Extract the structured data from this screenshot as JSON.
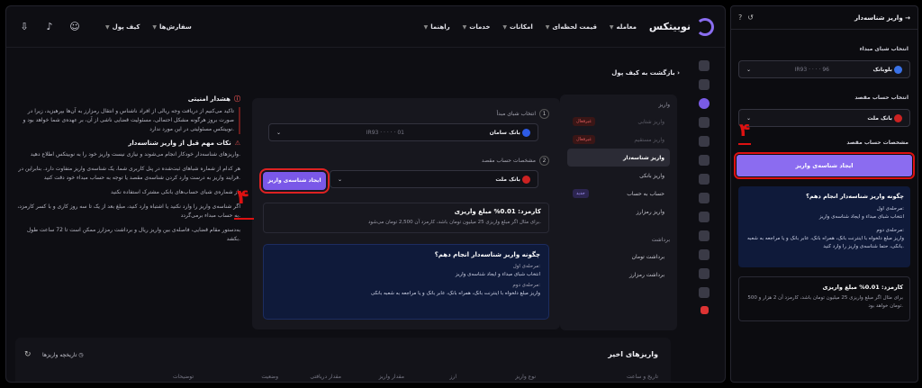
{
  "topbar": {
    "logo": "نوبیتکس",
    "nav": [
      "معامله",
      "قیمت لحظه‌ای",
      "امکانات",
      "خدمات",
      "راهنما"
    ],
    "menu": [
      "سفارش‌ها",
      "کیف پول"
    ]
  },
  "breadcrumb": "بازگشت به کیف پول",
  "deposit_menu": {
    "title": "واریز",
    "items": [
      {
        "label": "واریز شتابی",
        "badge": "غیرفعال"
      },
      {
        "label": "واریز مستقیم",
        "badge": "غیرفعال"
      },
      {
        "label": "واریز شناسه‌دار",
        "badge": ""
      },
      {
        "label": "واریز بانکی",
        "badge": ""
      },
      {
        "label": "حساب به حساب",
        "badge": "جدید"
      },
      {
        "label": "واریز رمزارز",
        "badge": ""
      }
    ],
    "withdraw_title": "برداشت",
    "withdraw_items": [
      "برداشت تومان",
      "برداشت رمزارز"
    ]
  },
  "form": {
    "step1_label": "انتخاب شبای مبدأ",
    "step1_num": "1",
    "source_bank": "بانک سامان",
    "source_iban_start": "IR93",
    "source_iban_end": "01",
    "step2_label": "مشخصات حساب مقصد",
    "step2_num": "2",
    "dest_bank": "بانک ملت",
    "create_button": "ایجاد شناسه‌ی واریز",
    "fee_title": "کارمزد: 0.01% مبلغ واریزی",
    "fee_text": "برای مثال اگر مبلغ واریزی 25 میلیون تومان باشد، کارمزد آن 2,500 تومان می‌شود.",
    "how_title": "چگونه واریز شناسه‌دار انجام دهم؟",
    "how_step1_label": "مرحله‌ی اول:",
    "how_step1": "انتخاب شبای مبداء و ایجاد شناسه‌ی واریز",
    "how_step2_label": "مرحله‌ی دوم:",
    "how_step2": "واریز مبلغ دلخواه با اینترنت بانک، همراه بانک، عابر بانک و یا مراجعه به شعبه بانکی"
  },
  "notes": {
    "security_title": "هشدار امنیتی",
    "security_text": "تاکید می‌کنیم از دریافت وجه ریالی از افراد ناشناس و انتقال رمزارز به آن‌ها بپرهیزید، زیرا در صورت بروز هرگونه مشکل احتمالی، مسئولیت قضایی ناشی از آن، بر عهده‌ی شما خواهد بود و نوبیتکس مسئولیتی در این مورد ندارد.",
    "tips_title": "نکات مهم قبل از واریز شناسه‌دار",
    "tips": [
      "واریزهای شناسه‌دار خودکار انجام می‌شوند و نیازی نیست واریز خود را به نوبیتکس اطلاع دهید.",
      "هر کدام از شماره شباهای ثبت‌شده در پنل کاربری شما، یک شناسه‌ی واریز متفاوت دارد. بنابراین در فرایند واریز به درست وارد کردن شناسه‌ی مقصد یا توجه به حساب مبداء خود دقت کنید.",
      "از شماره‌ی شبای حساب‌های بانکی مشترک استفاده نکنید.",
      "اگر شناسه‌ی واریز را وارد نکنید یا اشتباه وارد کنید، مبلغ بعد از یک تا سه روز کاری و با کسر کارمزد، به حساب مبداء برمی‌گردد.",
      "به‌دستور مقام قضایی، فاصله‌ی بین واریز ریال و برداشت رمزارز ممکن است تا 72 ساعت طول بکشد."
    ]
  },
  "annotation": "۴",
  "recent": {
    "title": "واریزهای اخیر",
    "history": "تاریخچه واریزها",
    "columns": [
      "تاریخ و ساعت",
      "نوع واریز",
      "ارز",
      "مقدار واریز",
      "مقدار دریافتی",
      "وضعیت",
      "توضیحات"
    ]
  },
  "panel": {
    "title": "واریز شناسه‌دار",
    "source_label": "انتخاب شبای مبداء",
    "source_bank": "بلوبانک",
    "source_iban_start": "IR93",
    "source_iban_end": "96",
    "dest_label": "انتخاب حساب مقصد",
    "dest_bank": "بانک ملت",
    "dest_info_label": "مشخصات حساب مقصد",
    "create_button": "ایجاد شناسه‌ی واریز",
    "how_title": "چگونه واریز شناسه‌دار انجام دهم؟",
    "step1_label": "مرحله‌ی اول:",
    "step1": "انتخاب شبای مبداء و ایجاد شناسه‌ی واریز",
    "step2_label": "مرحله‌ی دوم:",
    "step2": "واریز مبلغ دلخواه با اینترنت بانک، همراه بانک، عابر بانک و یا مراجعه به شعبه بانکی، حتما شناسه‌ی واریز را وارد کنید.",
    "fee_title": "کارمزد: 0.01% مبلغ واریزی",
    "fee_text": "برای مثال اگر مبلغ واریزی 25 میلیون تومان باشد، کارمزد آن 2 هزار و 500 تومان خواهد بود."
  },
  "colors": {
    "accent": "#7a58e8",
    "highlight": "#d11111",
    "info_bg": "#0f1a3a"
  }
}
